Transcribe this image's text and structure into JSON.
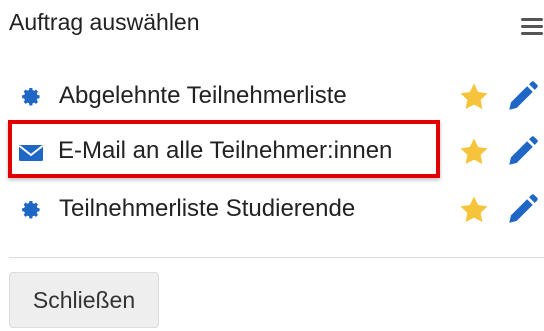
{
  "dialog": {
    "title": "Auftrag auswählen",
    "menu_icon": "hamburger-menu-icon"
  },
  "items": [
    {
      "label": "Abgelehnte Teilnehmerliste",
      "icon": "gear-icon",
      "favorite_icon": "star-icon",
      "edit_icon": "pencil-icon"
    },
    {
      "label": "E-Mail an alle Teilnehmer:innen",
      "icon": "envelope-icon",
      "favorite_icon": "star-icon",
      "edit_icon": "pencil-icon",
      "highlighted": true
    },
    {
      "label": "Teilnehmerliste Studierende",
      "icon": "gear-icon",
      "favorite_icon": "star-icon",
      "edit_icon": "pencil-icon"
    }
  ],
  "footer": {
    "close_label": "Schließen"
  },
  "colors": {
    "accent": "#1f67c4",
    "star": "#f6c43a",
    "highlight_border": "#e00000"
  }
}
